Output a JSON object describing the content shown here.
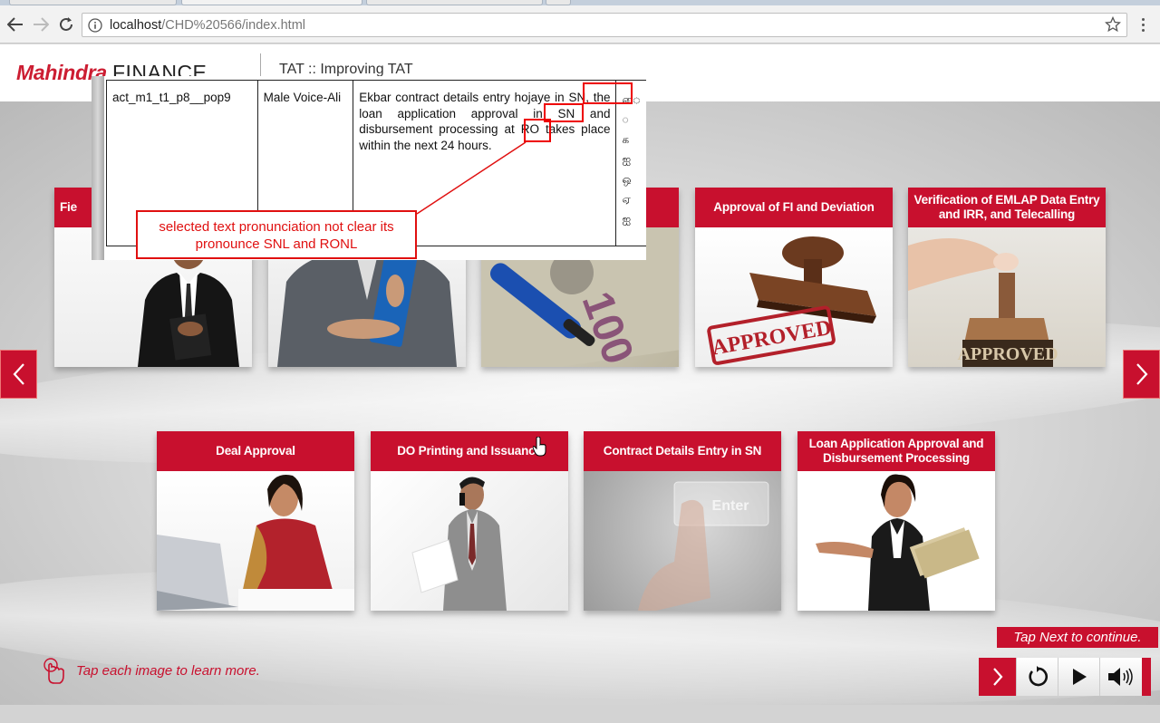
{
  "browser": {
    "url_host": "localhost",
    "url_path": "/CHD%20566/index.html"
  },
  "header": {
    "logo_red": "Mahindra",
    "logo_black": "FINANCE",
    "title": "TAT :: Improving TAT"
  },
  "cards_top": [
    {
      "label": "Fie"
    },
    {
      "label": ""
    },
    {
      "label": ""
    },
    {
      "label": "Approval of FI and Deviation"
    },
    {
      "label": "Verification of EMLAP Data Entry and IRR, and Telecalling"
    }
  ],
  "cards_bottom": [
    {
      "label": "Deal Approval"
    },
    {
      "label": "DO Printing and Issuance"
    },
    {
      "label": "Contract Details Entry in SN"
    },
    {
      "label": "Loan Application Approval and Disbursement Processing"
    }
  ],
  "card_images": {
    "approved_stamp_1": "APPROVED",
    "approved_stamp_2": "APPROVED",
    "enter_key": "Enter"
  },
  "footer": {
    "tap_hint": "Tap each image to learn more.",
    "tap_next": "Tap Next to continue."
  },
  "popup": {
    "col1": "act_m1_t1_p8__pop9",
    "col2": "Male Voice-Ali",
    "col3": "Ekbar contract details entry hojaye in SN, the loan application approval in SN and disbursement processing at RO takes place within the next 24 hours.",
    "col4": "ை ◌ க ஐ ஒ ஏ ஐ"
  },
  "annotation": {
    "callout": "selected text pronunciation not clear its pronounce SNL and RONL"
  },
  "colors": {
    "brand_red": "#c8102e",
    "annotation_red": "#e01010"
  }
}
